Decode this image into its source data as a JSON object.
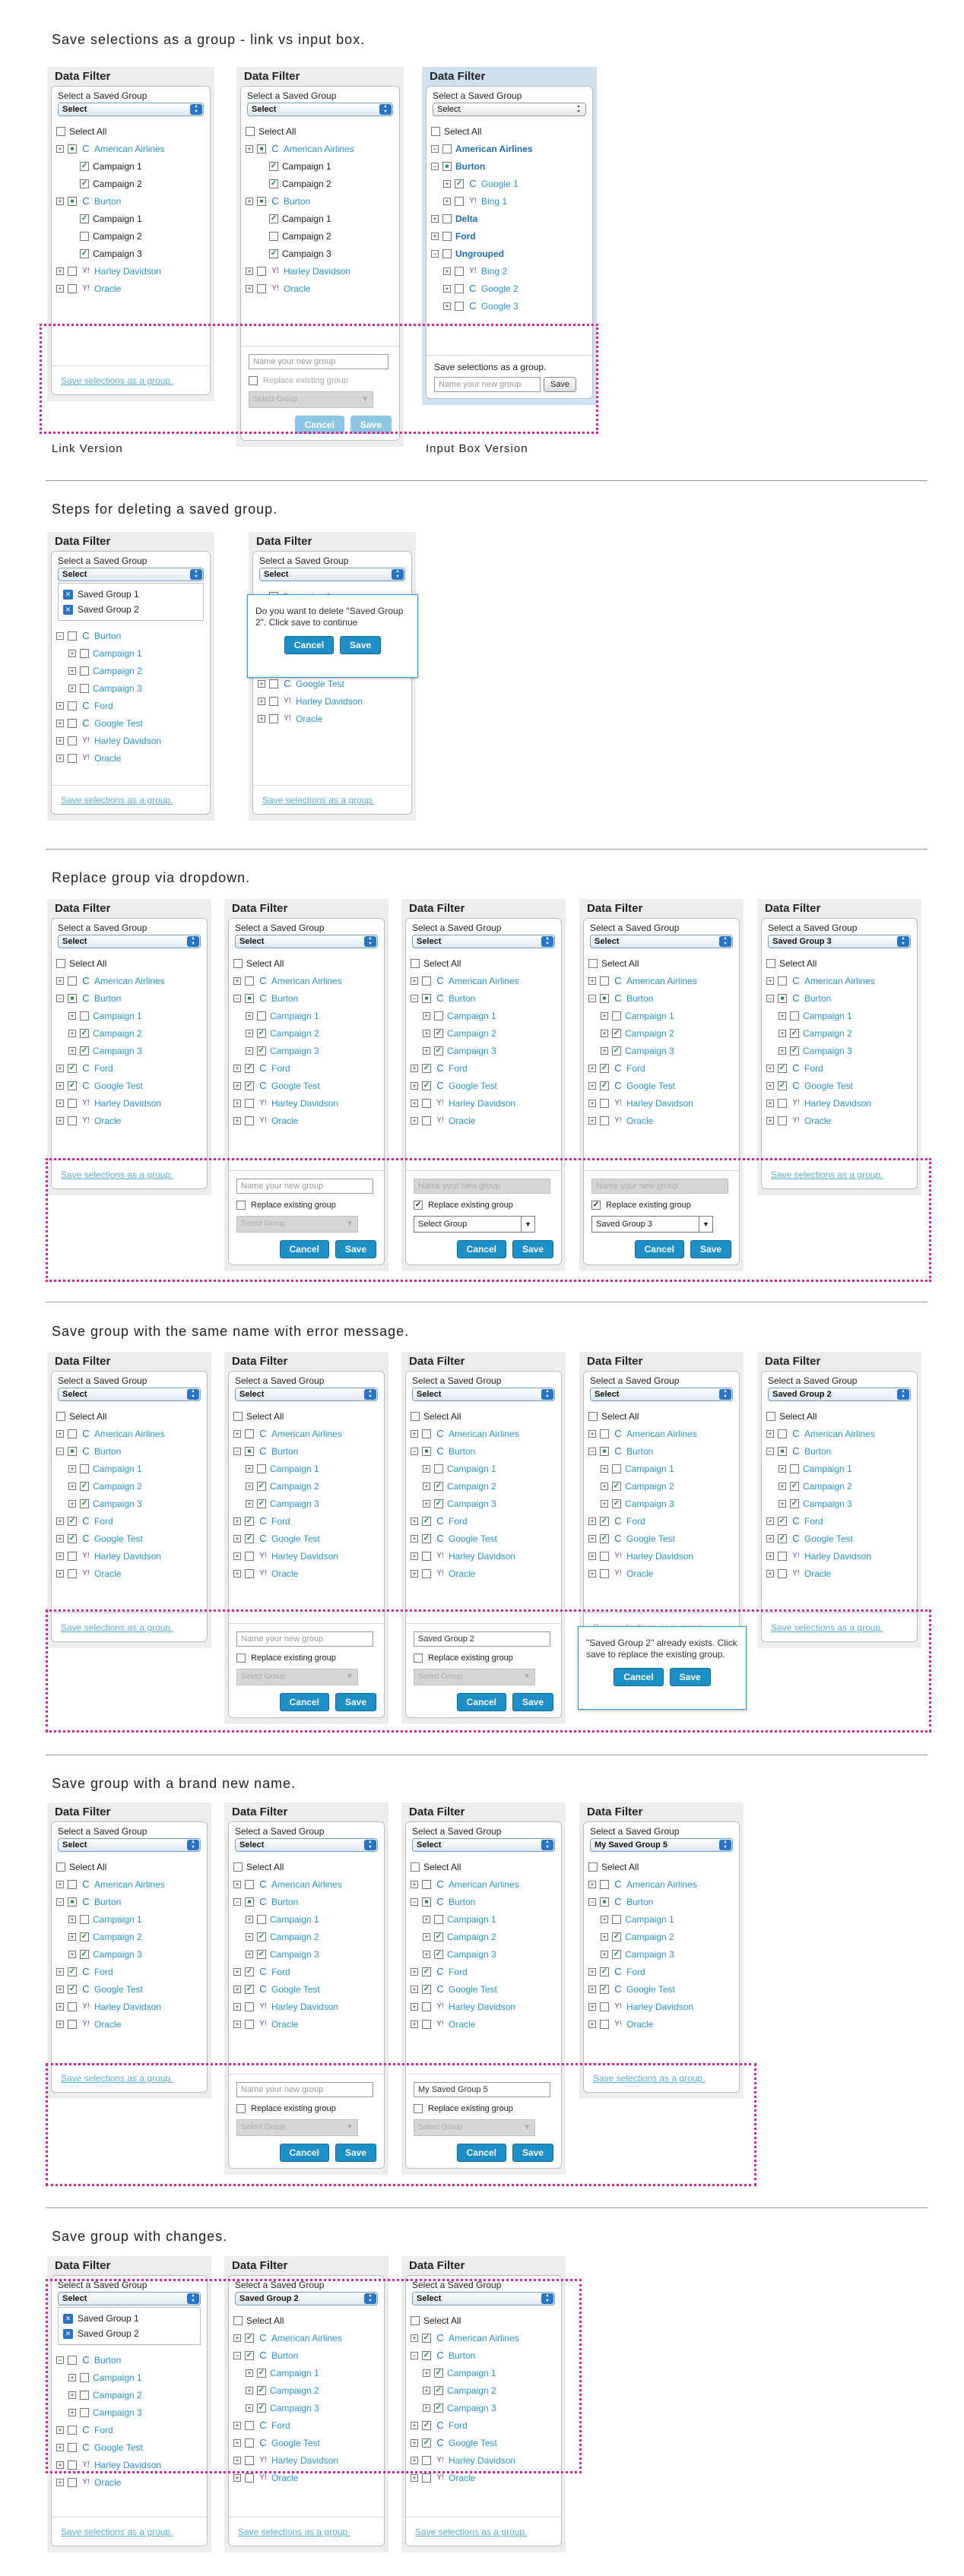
{
  "sections": [
    {
      "title": "Save selections as a group - link vs input box."
    },
    {
      "title": "Steps for deleting a saved group."
    },
    {
      "title": "Replace group via dropdown."
    },
    {
      "title": "Save group with the same name with error message."
    },
    {
      "title": "Save group with a brand new name."
    },
    {
      "title": "Save group with changes."
    }
  ],
  "captions": {
    "link": "Link Version",
    "input": "Input Box Version"
  },
  "panel": {
    "title": "Data Filter",
    "select_label": "Select a Saved Group",
    "select_default": "Select",
    "select_all": "Select All",
    "save_link": "Save selections as a group.",
    "name_placeholder": "Name your new group",
    "replace_label": "Replace existing group",
    "select_group": "Select Group",
    "cancel": "Cancel",
    "save": "Save",
    "save_btn_small": "Save",
    "save_group_label": "Save selections as a group."
  },
  "items": {
    "american": "American Airlines",
    "burton": "Burton",
    "c1": "Campaign 1",
    "c2": "Campaign 2",
    "c3": "Campaign 3",
    "harley": "Harley Davidson",
    "oracle": "Oracle",
    "delta": "Delta",
    "ford": "Ford",
    "ungrouped": "Ungrouped",
    "google1": "Google 1",
    "bing1": "Bing 1",
    "bing2": "Bing 2",
    "google2": "Google 2",
    "google3": "Google 3",
    "googletest": "Google Test"
  },
  "saved_groups": [
    "Saved Group 1",
    "Saved Group 2"
  ],
  "values": {
    "sg2": "Saved Group 2",
    "sg3": "Saved Group 3",
    "mysg5": "My Saved Group 5"
  },
  "dialogs": {
    "delete": "Do you want to delete \"Saved Group 2\". Click save to continue",
    "exists": "\"Saved Group 2\" already exists. Click save to replace the existing group."
  },
  "colors": {
    "accent": "#1c90c6",
    "link": "#2596d1",
    "dotted": "#d6249f"
  }
}
